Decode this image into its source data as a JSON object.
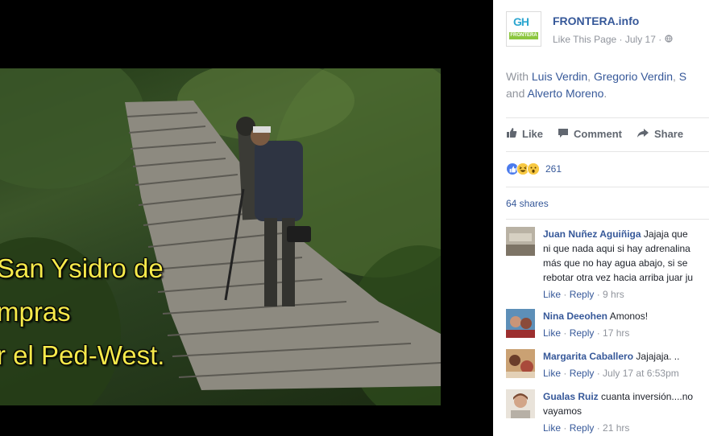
{
  "photo": {
    "caption_lines": [
      "San Ysidro de",
      "mpras",
      "r el Ped-West."
    ]
  },
  "post": {
    "page_name": "FRONTERA.info",
    "logo_text": "GH",
    "logo_subtext": "FRONTERA",
    "like_page_label": "Like This Page",
    "date": "July 17",
    "separator": "·",
    "privacy_icon": "globe-icon",
    "with_prefix": "With",
    "tagged": [
      "Luis Verdin",
      "Gregorio Verdin",
      "S"
    ],
    "tagged_last_prefix": "and",
    "tagged_last": "Alverto Moreno",
    "actions": {
      "like": "Like",
      "comment": "Comment",
      "share": "Share"
    },
    "reaction_count": "261",
    "shares": "64 shares"
  },
  "comments": [
    {
      "author": "Juan Nuñez Aguiñiga",
      "text": "Jajaja que ni que nada aqui si hay adrenalina más que no hay agua abajo, si se rebotar otra vez hacia arriba juar ju",
      "lines": [
        "Jajaja que",
        "ni que nada aqui si hay adrenalina",
        "más que no hay agua abajo, si se",
        "rebotar otra vez hacia arriba juar ju"
      ],
      "like": "Like",
      "reply": "Reply",
      "time": "9 hrs"
    },
    {
      "author": "Nina Deeohen",
      "text": "Amonos!",
      "like": "Like",
      "reply": "Reply",
      "time": "17 hrs"
    },
    {
      "author": "Margarita Caballero",
      "text": "Jajajaja. ..",
      "like": "Like",
      "reply": "Reply",
      "time": "July 17 at 6:53pm"
    },
    {
      "author": "Gualas Ruiz",
      "text": "cuanta inversión....no vayamos",
      "lines": [
        "cuanta inversión....no",
        "vayamos"
      ],
      "like": "Like",
      "reply": "Reply",
      "time": "21 hrs"
    }
  ],
  "colors": {
    "link": "#365899",
    "muted": "#90949c",
    "caption": "#f5e94a"
  }
}
